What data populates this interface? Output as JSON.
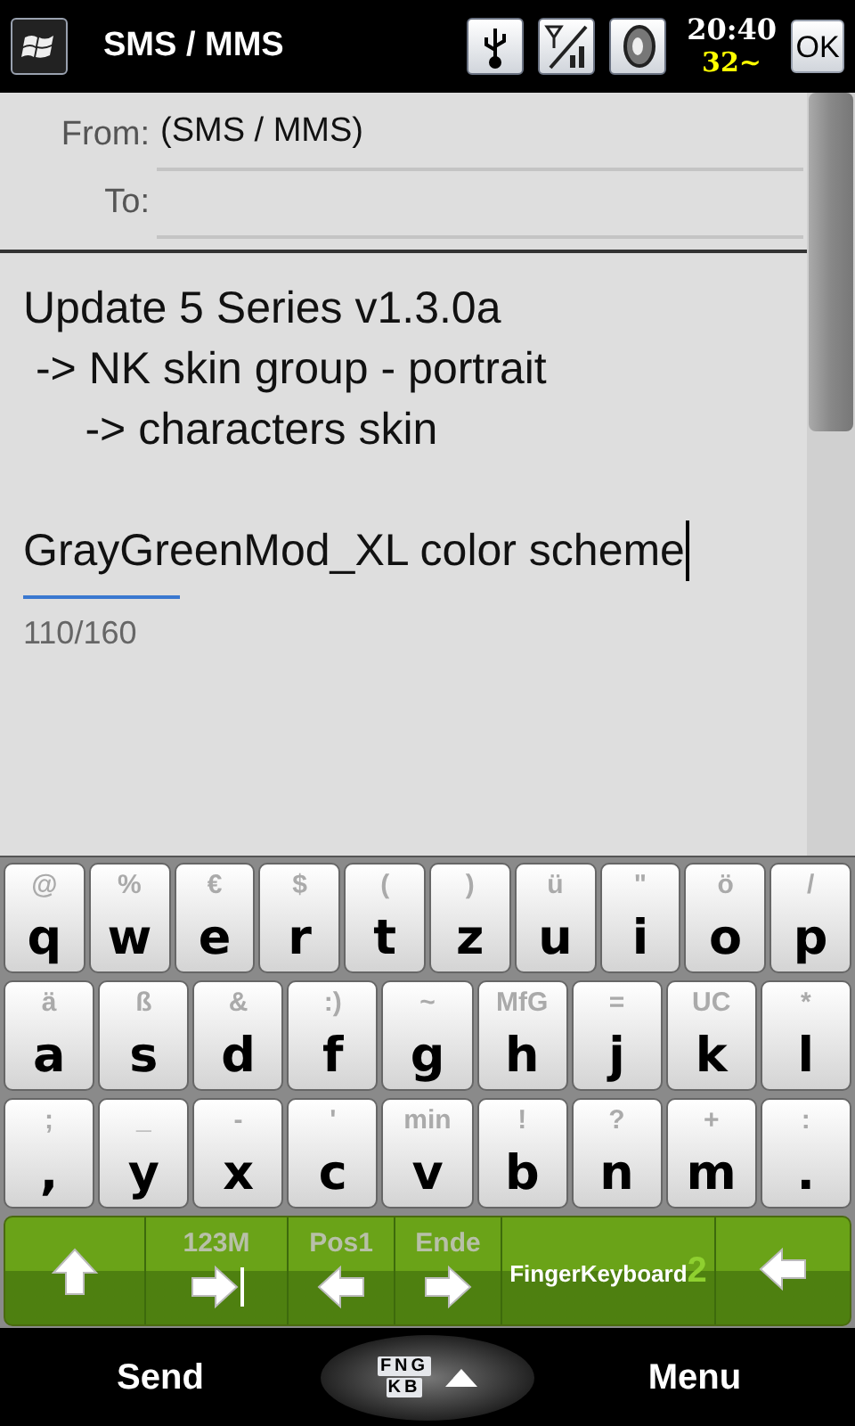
{
  "title_bar": {
    "title": "SMS / MMS",
    "time": "20:40",
    "battery": "32~",
    "ok": "OK"
  },
  "header": {
    "from_label": "From:",
    "from_value": "(SMS / MMS)",
    "to_label": "To:"
  },
  "message": {
    "paragraphs": [
      [
        "Update 5 Series v1.3.0a",
        " -> NK skin group - portrait",
        "     -> characters skin"
      ],
      [
        "GrayGreenMod_XL color scheme"
      ]
    ],
    "counter": "110/160"
  },
  "keyboard": {
    "rows": [
      {
        "keys": [
          {
            "main": "q",
            "alt": "@"
          },
          {
            "main": "w",
            "alt": "%"
          },
          {
            "main": "e",
            "alt": "€"
          },
          {
            "main": "r",
            "alt": "$"
          },
          {
            "main": "t",
            "alt": "("
          },
          {
            "main": "z",
            "alt": ")"
          },
          {
            "main": "u",
            "alt": "ü"
          },
          {
            "main": "i",
            "alt": "\""
          },
          {
            "main": "o",
            "alt": "ö"
          },
          {
            "main": "p",
            "alt": "/"
          }
        ]
      },
      {
        "keys": [
          {
            "main": "a",
            "alt": "ä"
          },
          {
            "main": "s",
            "alt": "ß"
          },
          {
            "main": "d",
            "alt": "&"
          },
          {
            "main": "f",
            "alt": ":)"
          },
          {
            "main": "g",
            "alt": "~"
          },
          {
            "main": "h",
            "alt": "MfG"
          },
          {
            "main": "j",
            "alt": "="
          },
          {
            "main": "k",
            "alt": "UC"
          },
          {
            "main": "l",
            "alt": "*"
          }
        ]
      },
      {
        "keys": [
          {
            "main": ",",
            "alt": ";"
          },
          {
            "main": "y",
            "alt": "_"
          },
          {
            "main": "x",
            "alt": "-"
          },
          {
            "main": "c",
            "alt": "'"
          },
          {
            "main": "v",
            "alt": "min"
          },
          {
            "main": "b",
            "alt": "!"
          },
          {
            "main": "n",
            "alt": "?"
          },
          {
            "main": "m",
            "alt": "+"
          },
          {
            "main": ".",
            "alt": ":"
          }
        ]
      }
    ],
    "function_row": [
      {
        "kind": "shift"
      },
      {
        "kind": "tab",
        "alt": "123M"
      },
      {
        "kind": "left",
        "alt": "Pos1"
      },
      {
        "kind": "right",
        "alt": "Ende"
      },
      {
        "kind": "brand",
        "label": "FingerKeyboard",
        "sup": "2"
      },
      {
        "kind": "backspace"
      }
    ]
  },
  "softkeys": {
    "left": "Send",
    "logo_top": "FNG",
    "logo_bottom": "KB",
    "right": "Menu"
  }
}
